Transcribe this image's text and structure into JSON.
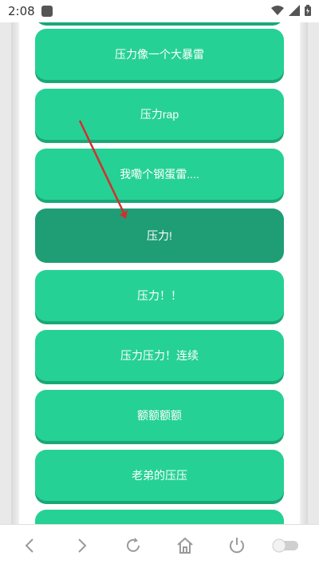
{
  "status_bar": {
    "time": "2:08"
  },
  "sound_buttons": [
    "压力像一个大暴雷",
    "压力rap",
    "我嘞个钢蛋雷....",
    "压力!",
    "压力！！",
    "压力压力！连续",
    "额额额额",
    "老弟的压压"
  ],
  "colors": {
    "button": "#26d195",
    "button_pressed": "#1f9e75",
    "arrow": "#d32f2f"
  },
  "nav_icons": [
    "back-icon",
    "forward-icon",
    "reload-icon",
    "home-icon",
    "power-icon",
    "toggle-icon"
  ]
}
